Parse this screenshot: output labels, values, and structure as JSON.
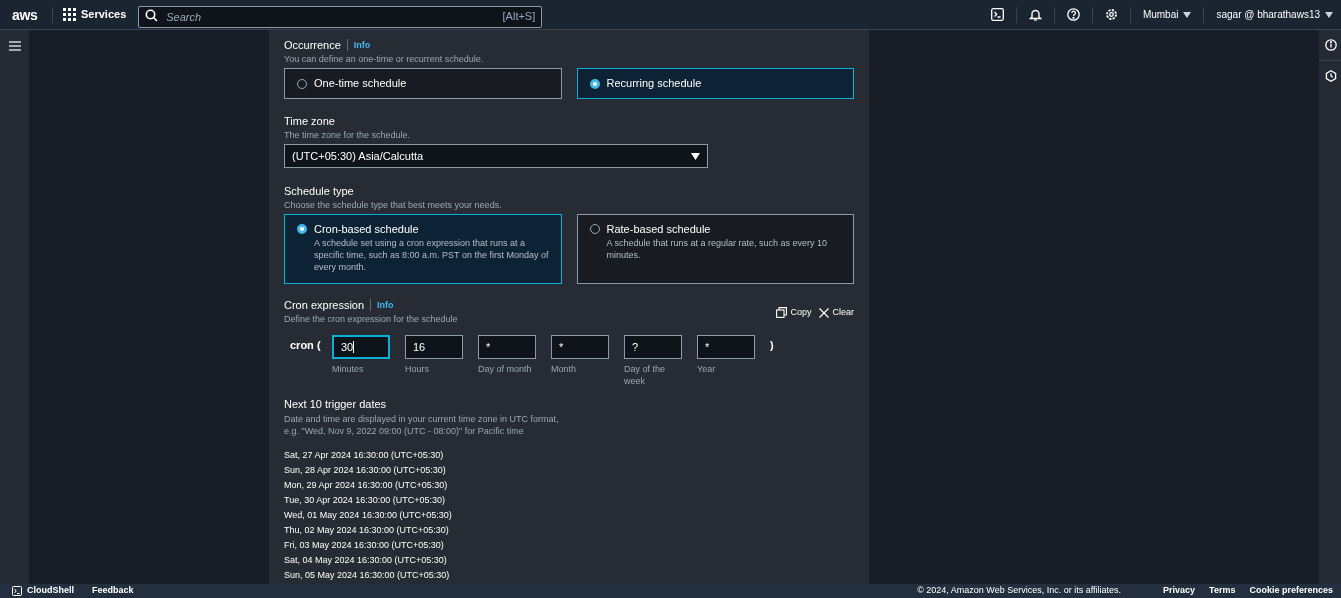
{
  "nav": {
    "logo": "aws",
    "services": "Services",
    "search_placeholder": "Search",
    "search_shortcut": "[Alt+S]",
    "region": "Mumbai",
    "account": "sagar @ bharathaws13"
  },
  "occurrence": {
    "label": "Occurrence",
    "info": "Info",
    "description": "You can define an one-time or recurrent schedule.",
    "options": [
      {
        "label": "One-time schedule",
        "selected": false
      },
      {
        "label": "Recurring schedule",
        "selected": true
      }
    ]
  },
  "time_zone": {
    "label": "Time zone",
    "description": "The time zone for the schedule.",
    "value": "(UTC+05:30) Asia/Calcutta"
  },
  "schedule_type": {
    "label": "Schedule type",
    "description": "Choose the schedule type that best meets your needs.",
    "options": [
      {
        "label": "Cron-based schedule",
        "description": "A schedule set using a cron expression that runs at a specific time, such as 8:00 a.m. PST on the first Monday of every month.",
        "selected": true
      },
      {
        "label": "Rate-based schedule",
        "description": "A schedule that runs at a regular rate, such as every 10 minutes.",
        "selected": false
      }
    ]
  },
  "cron": {
    "label": "Cron expression",
    "info": "Info",
    "description": "Define the cron expression for the schedule",
    "copy": "Copy",
    "clear": "Clear",
    "prefix": "cron (",
    "suffix": ")",
    "fields": [
      {
        "value": "30",
        "label": "Minutes",
        "focused": true
      },
      {
        "value": "16",
        "label": "Hours",
        "focused": false
      },
      {
        "value": "*",
        "label": "Day of month",
        "focused": false
      },
      {
        "value": "*",
        "label": "Month",
        "focused": false
      },
      {
        "value": "?",
        "label": "Day of the week",
        "focused": false
      },
      {
        "value": "*",
        "label": "Year",
        "focused": false
      }
    ]
  },
  "trigger_dates": {
    "title": "Next 10 trigger dates",
    "description": "Date and time are displayed in your current time zone in UTC format, e.g. \"Wed, Nov 9, 2022 09:00 (UTC - 08:00)\" for Pacific time",
    "dates": [
      "Sat, 27 Apr 2024 16:30:00 (UTC+05:30)",
      "Sun, 28 Apr 2024 16:30:00 (UTC+05:30)",
      "Mon, 29 Apr 2024 16:30:00 (UTC+05:30)",
      "Tue, 30 Apr 2024 16:30:00 (UTC+05:30)",
      "Wed, 01 May 2024 16:30:00 (UTC+05:30)",
      "Thu, 02 May 2024 16:30:00 (UTC+05:30)",
      "Fri, 03 May 2024 16:30:00 (UTC+05:30)",
      "Sat, 04 May 2024 16:30:00 (UTC+05:30)",
      "Sun, 05 May 2024 16:30:00 (UTC+05:30)"
    ]
  },
  "footer": {
    "cloudshell": "CloudShell",
    "feedback": "Feedback",
    "copyright": "© 2024, Amazon Web Services, Inc. or its affiliates.",
    "links": [
      "Privacy",
      "Terms",
      "Cookie preferences"
    ]
  }
}
